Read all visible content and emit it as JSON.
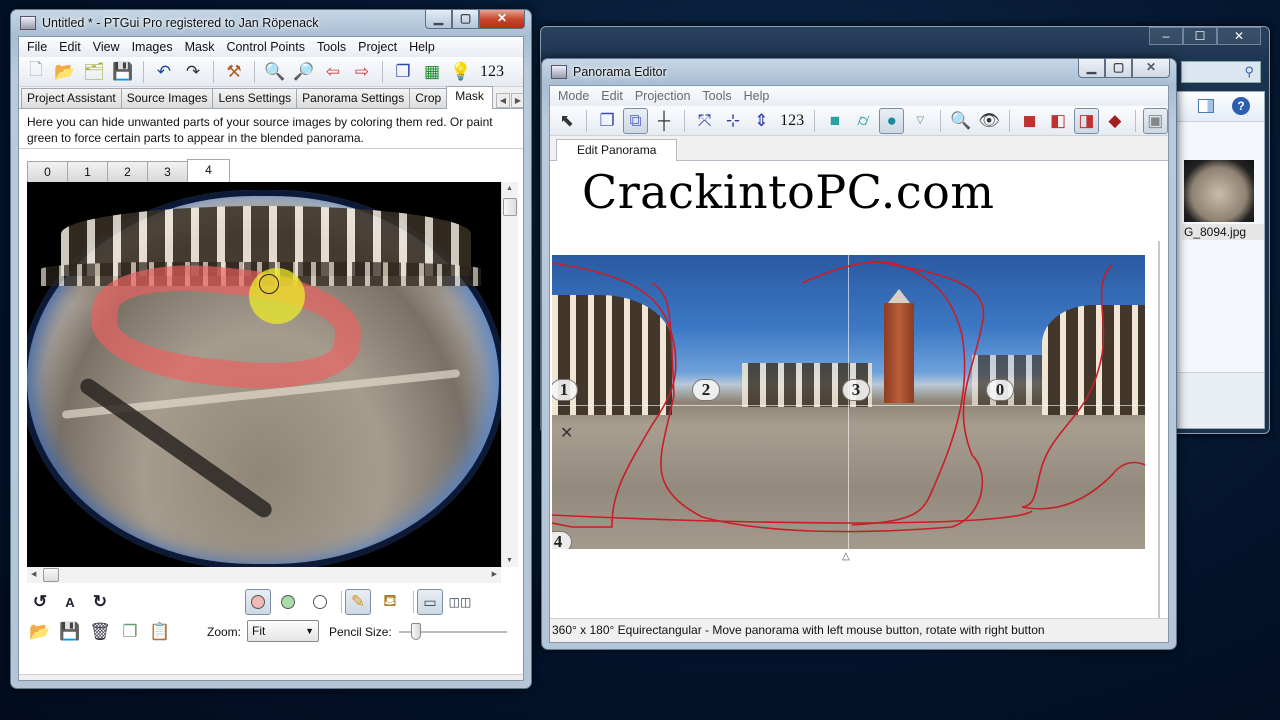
{
  "background_window": {
    "file_label": "G_8094.jpg",
    "caption_buttons": [
      "–",
      "☐",
      "✕"
    ]
  },
  "ptgui": {
    "title": "Untitled * - PTGui Pro registered to Jan Röpenack",
    "menu": [
      "File",
      "Edit",
      "View",
      "Images",
      "Mask",
      "Control Points",
      "Tools",
      "Project",
      "Help"
    ],
    "toolbar": {
      "icons": [
        "new-project-icon",
        "open-project-icon",
        "load-images-icon",
        "save-icon",
        "undo-icon",
        "redo-icon",
        "tools-icon",
        "zoom-in-icon",
        "zoom-out-icon",
        "previous-icon",
        "next-icon",
        "panorama-editor-icon",
        "table-icon",
        "tip-icon"
      ],
      "numbers_label": "123"
    },
    "tabs": [
      {
        "label": "Project Assistant",
        "active": false
      },
      {
        "label": "Source Images",
        "active": false
      },
      {
        "label": "Lens Settings",
        "active": false
      },
      {
        "label": "Panorama Settings",
        "active": false
      },
      {
        "label": "Crop",
        "active": false
      },
      {
        "label": "Mask",
        "active": true
      }
    ],
    "mask_hint": "Here you can hide unwanted parts of your source images by coloring them red. Or paint green to force certain parts to appear in the blended panorama.",
    "image_tabs": [
      {
        "label": "0",
        "active": false
      },
      {
        "label": "1",
        "active": false
      },
      {
        "label": "2",
        "active": false
      },
      {
        "label": "3",
        "active": false
      },
      {
        "label": "4",
        "active": true
      }
    ],
    "mask_colors": {
      "red": "#f05f5f",
      "green_brush": "#ebeb28"
    },
    "zoom_label": "Zoom:",
    "zoom_value": "Fit",
    "pencil_size_label": "Pencil Size:",
    "pencil_size_fraction": 0.12,
    "active_color": "red",
    "active_tool": "pencil",
    "active_view": "single"
  },
  "panorama_editor": {
    "title": "Panorama Editor",
    "menu": [
      "Mode",
      "Edit",
      "Projection",
      "Tools",
      "Help"
    ],
    "toolbar": {
      "numbers_label": "123",
      "active_tools": [
        "edit-individual-images",
        "sphere-projection",
        "show-seams"
      ]
    },
    "tab_label": "Edit Panorama",
    "watermark": "CrackintoPC.com",
    "image_markers": [
      "1",
      "2",
      "3",
      "0",
      "4"
    ],
    "status": "360° x 180° Equirectangular - Move panorama with left mouse button, rotate with right button",
    "horizontal_slider_fraction": 0.99,
    "vertical_slider_fraction": 1.0,
    "seam_color": "#c81e28"
  }
}
